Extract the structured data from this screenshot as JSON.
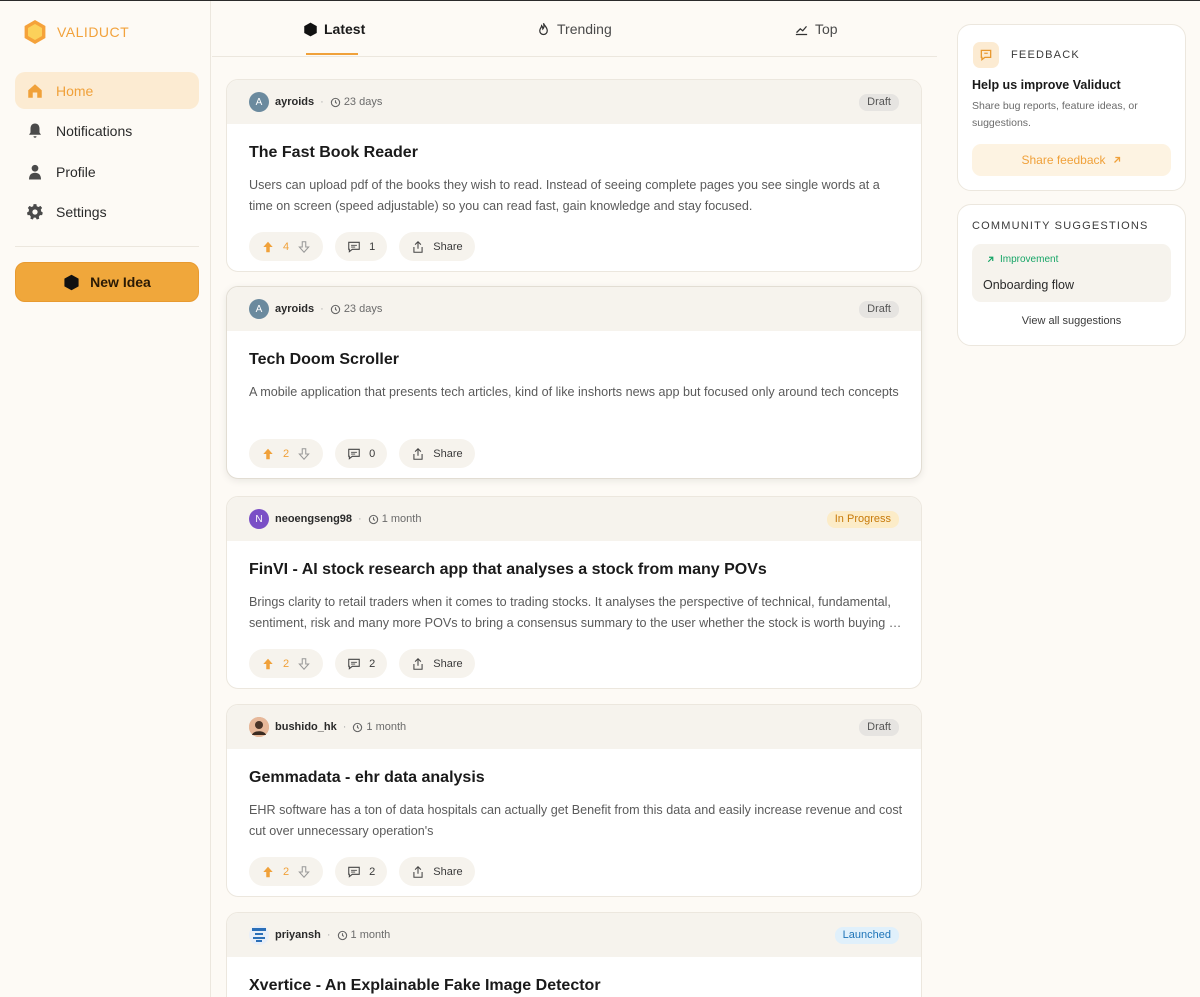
{
  "brand": {
    "name": "VALIDUCT"
  },
  "sidebar": {
    "items": [
      {
        "label": "Home",
        "icon": "home-icon",
        "active": true
      },
      {
        "label": "Notifications",
        "icon": "bell-icon"
      },
      {
        "label": "Profile",
        "icon": "user-icon"
      },
      {
        "label": "Settings",
        "icon": "gear-icon"
      }
    ],
    "new_idea_label": "New Idea"
  },
  "tabs": [
    {
      "label": "Latest",
      "icon": "hexagon-icon",
      "active": true
    },
    {
      "label": "Trending",
      "icon": "flame-icon"
    },
    {
      "label": "Top",
      "icon": "chart-line-icon"
    }
  ],
  "posts": [
    {
      "avatar": "A",
      "avatar_color": "#6b8a9e",
      "author": "ayroids",
      "time": "23 days",
      "status": "Draft",
      "status_kind": "draft",
      "title": "The Fast Book Reader",
      "description": "Users can upload pdf of the books they wish to read. Instead of seeing complete pages you see single words at a time on screen (speed adjustable) so you can read fast, gain knowledge and stay focused.",
      "votes": "4",
      "comments": "1",
      "share_label": "Share"
    },
    {
      "avatar": "A",
      "avatar_color": "#6b8a9e",
      "author": "ayroids",
      "time": "23 days",
      "status": "Draft",
      "status_kind": "draft",
      "title": "Tech Doom Scroller",
      "description": "A mobile application that presents tech articles, kind of like inshorts news app but focused only around tech concepts",
      "votes": "2",
      "comments": "0",
      "share_label": "Share"
    },
    {
      "avatar": "N",
      "avatar_color": "#7a4fc6",
      "author": "neoengseng98",
      "time": "1 month",
      "status": "In Progress",
      "status_kind": "progress",
      "title": "FinVI - AI stock research app that analyses a stock from many POVs",
      "description": "Brings clarity to retail traders when it comes to trading stocks. It analyses the perspective of technical, fundamental, sentiment, risk and many more POVs to bring a consensus summary to the user whether the stock is worth buying or not.",
      "votes": "2",
      "comments": "2",
      "share_label": "Share"
    },
    {
      "avatar": "",
      "avatar_color": "#d9a98a",
      "author": "bushido_hk",
      "time": "1 month",
      "status": "Draft",
      "status_kind": "draft",
      "title": "Gemmadata - ehr data analysis",
      "description": "EHR software has a ton of data hospitals can actually get Benefit from this data and easily increase revenue and cost cut over unnecessary operation's",
      "votes": "2",
      "comments": "2",
      "share_label": "Share"
    },
    {
      "avatar": "",
      "avatar_color": "#e8eef7",
      "author": "priyansh",
      "time": "1 month",
      "status": "Launched",
      "status_kind": "launched",
      "title": "Xvertice - An Explainable Fake Image Detector",
      "description": "",
      "votes": "",
      "comments": "",
      "share_label": "Share"
    }
  ],
  "feedback": {
    "label": "FEEDBACK",
    "title": "Help us improve Validuct",
    "description": "Share bug reports, feature ideas, or suggestions.",
    "button_label": "Share feedback"
  },
  "community": {
    "label": "COMMUNITY SUGGESTIONS",
    "item_tag": "Improvement",
    "item_title": "Onboarding flow",
    "view_all_label": "View all suggestions"
  },
  "colors": {
    "accent": "#f0a13a",
    "background": "#fdfaf5",
    "success": "#17a567"
  }
}
